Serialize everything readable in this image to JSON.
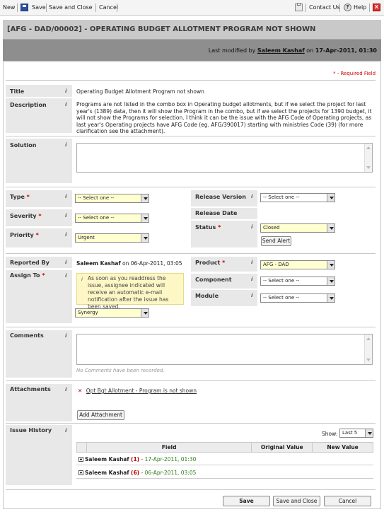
{
  "toolbar": {
    "new": "New",
    "save": "Save",
    "save_close": "Save and Close",
    "cancel": "Cancel",
    "contact": "Contact Us",
    "help": "Help",
    "close_title": "X"
  },
  "header": {
    "title": "[AFG - DAD/00002]  -  OPERATING BUDGET ALLOTMENT PROGRAM NOT SHOWN",
    "modified_prefix": "Last modified by",
    "modified_user": "Saleem Kashaf",
    "modified_on": "on",
    "modified_date": "17-Apr-2011, 01:30"
  },
  "required_note": "* - Required Field",
  "fields": {
    "title_label": "Title",
    "title_value": "Operating Budget Allotment Program not shown",
    "description_label": "Description",
    "description_value": "Programs are not listed in the combo box in Operating budget allotments, but if we select the project for last year's (1389) data, then it will show the Program in the combo, but if we select the projects for 1390 budget, it will not show the Programs for selection. I think it can be the issue with the AFG Code of Operating projects, as last year's Operating projects have AFG Code (eg. AFG/390017) starting with ministries Code (39) (for more clarification see the attachment).",
    "solution_label": "Solution",
    "type_label": "Type",
    "type_value": "-- Select one --",
    "severity_label": "Severity",
    "severity_value": "-- Select one --",
    "priority_label": "Priority",
    "priority_value": "Urgent",
    "release_version_label": "Release Version",
    "release_version_value": "-- Select one --",
    "release_date_label": "Release Date",
    "status_label": "Status",
    "status_value": "Closed",
    "send_alert": "Send Alert",
    "reported_by_label": "Reported By",
    "reported_by_user": "Saleem Kashaf",
    "reported_on": "on 06-Apr-2011, 03:05",
    "assign_to_label": "Assign To",
    "assign_hint": "As soon as you readdress the issue, assignee indicated will receive an automatic e-mail notification after the issue has been saved.",
    "assign_value": "Synergy",
    "product_label": "Product",
    "product_value": "AFG - DAD",
    "component_label": "Component",
    "component_value": "-- Select one --",
    "module_label": "Module",
    "module_value": "-- Select one --",
    "comments_label": "Comments",
    "comments_note": "No Comments have been recorded.",
    "attachments_label": "Attachments",
    "attachment_name": "Opt Bgt Allotment - Program is not shown",
    "add_attachment": "Add Attachment",
    "history_label": "Issue History",
    "show_label": "Show:",
    "show_value": "Last 5",
    "col_field": "Field",
    "col_original": "Original Value",
    "col_new": "New Value",
    "info_glyph": "i"
  },
  "history": [
    {
      "user": "Saleem Kashaf",
      "count": "(1)",
      "sep": "-",
      "date": "17-Apr-2011, 01:30"
    },
    {
      "user": "Saleem Kashaf",
      "count": "(6)",
      "sep": "-",
      "date": "06-Apr-2011, 03:05"
    }
  ],
  "footer": {
    "save": "Save",
    "save_close": "Save and Close",
    "cancel": "Cancel"
  },
  "colors": {
    "title_bar": "#c9c9c9",
    "modified_bar": "#8e8e8e",
    "label_bg": "#e8e8e8",
    "select_highlight": "#ffffd0",
    "required": "#cc0000"
  }
}
